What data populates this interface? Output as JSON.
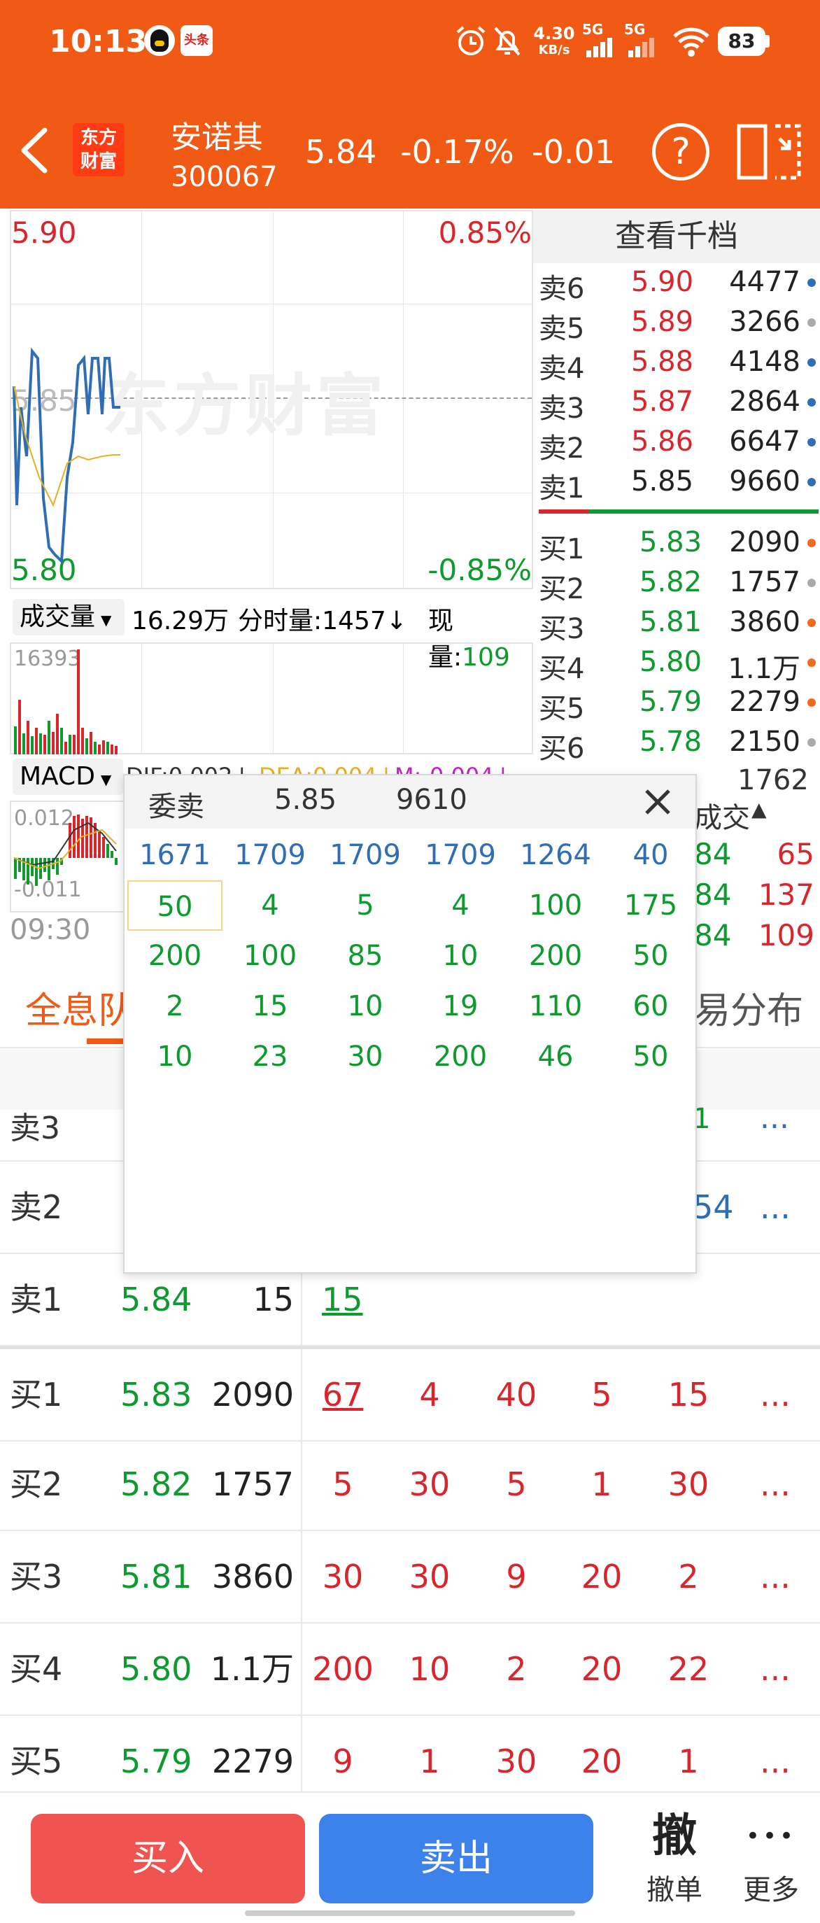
{
  "status_bar": {
    "time": "10:13",
    "app_badge": "头条",
    "net_speed": "4.30",
    "net_unit": "KB/s",
    "signal1": "5G",
    "signal2": "5G",
    "battery": "83"
  },
  "header": {
    "logo": "东方财富",
    "stock_name": "安诺其",
    "stock_code": "300067",
    "price": "5.84",
    "change_pct": "-0.17%",
    "change": "-0.01",
    "help_icon": "?"
  },
  "chart": {
    "price_high": "5.90",
    "pct_high": "0.85%",
    "price_mid": "5.85",
    "price_low": "5.80",
    "pct_low": "-0.85%",
    "watermark": "东方财富",
    "volume_selector": "成交量",
    "total_volume": "16.29万",
    "minute_volume": "分时量:1457↓",
    "current_volume_label": "现量:",
    "current_volume": "109",
    "vol_max": "16393",
    "macd_selector": "MACD",
    "dif": "DIF:0.002↓",
    "dea": "DEA:0.004↓",
    "m": "M:-0.004↓",
    "macd_high": "0.012",
    "macd_low": "-0.011",
    "time_start": "09:30"
  },
  "depth": {
    "title": "查看千档",
    "asks": [
      {
        "label": "卖6",
        "price": "5.90",
        "vol": "4477"
      },
      {
        "label": "卖5",
        "price": "5.89",
        "vol": "3266"
      },
      {
        "label": "卖4",
        "price": "5.88",
        "vol": "4148"
      },
      {
        "label": "卖3",
        "price": "5.87",
        "vol": "2864"
      },
      {
        "label": "卖2",
        "price": "5.86",
        "vol": "6647"
      },
      {
        "label": "卖1",
        "price": "5.85",
        "vol": "9660"
      }
    ],
    "bids": [
      {
        "label": "买1",
        "price": "5.83",
        "vol": "2090"
      },
      {
        "label": "买2",
        "price": "5.82",
        "vol": "1757"
      },
      {
        "label": "买3",
        "price": "5.81",
        "vol": "3860"
      },
      {
        "label": "买4",
        "price": "5.80",
        "vol": "1.1万"
      },
      {
        "label": "买5",
        "price": "5.79",
        "vol": "2279"
      },
      {
        "label": "买6",
        "price": "5.78",
        "vol": "2150"
      }
    ],
    "partial_vol": "1762"
  },
  "trades": {
    "title": "成交",
    "rows": [
      {
        "price": "84",
        "vol": "65"
      },
      {
        "price": "84",
        "vol": "137"
      },
      {
        "price": "84",
        "vol": "109"
      }
    ]
  },
  "tabs": {
    "left": "全息队",
    "right": "易分布"
  },
  "popup": {
    "title": "委卖",
    "price": "5.85",
    "vol": "9610",
    "r0": [
      "1671",
      "1709",
      "1709",
      "1709",
      "1264",
      "40"
    ],
    "r1": [
      "50",
      "4",
      "5",
      "4",
      "100",
      "175"
    ],
    "r2": [
      "200",
      "100",
      "85",
      "10",
      "200",
      "50"
    ],
    "r3": [
      "2",
      "15",
      "10",
      "19",
      "110",
      "60"
    ],
    "r4": [
      "10",
      "23",
      "30",
      "200",
      "46",
      "50"
    ]
  },
  "book": {
    "more": "...",
    "sell3": {
      "label": "卖3",
      "tail": "1"
    },
    "sell2": {
      "label": "卖2",
      "tail": "54"
    },
    "sell1": {
      "label": "卖1",
      "price": "5.84",
      "vol": "15",
      "o": "15"
    },
    "buy1": {
      "label": "买1",
      "price": "5.83",
      "vol": "2090",
      "o": [
        "67",
        "4",
        "40",
        "5",
        "15"
      ]
    },
    "buy2": {
      "label": "买2",
      "price": "5.82",
      "vol": "1757",
      "o": [
        "5",
        "30",
        "5",
        "1",
        "30"
      ]
    },
    "buy3": {
      "label": "买3",
      "price": "5.81",
      "vol": "3860",
      "o": [
        "30",
        "30",
        "9",
        "20",
        "2"
      ]
    },
    "buy4": {
      "label": "买4",
      "price": "5.80",
      "vol": "1.1万",
      "o": [
        "200",
        "10",
        "2",
        "20",
        "22"
      ]
    },
    "buy5": {
      "label": "买5",
      "price": "5.79",
      "vol": "2279",
      "o": [
        "9",
        "1",
        "30",
        "20",
        "1"
      ]
    }
  },
  "bottom": {
    "buy": "买入",
    "sell": "卖出",
    "cancel_big": "撤",
    "cancel": "撤单",
    "more_dots": "•••",
    "more": "更多"
  }
}
